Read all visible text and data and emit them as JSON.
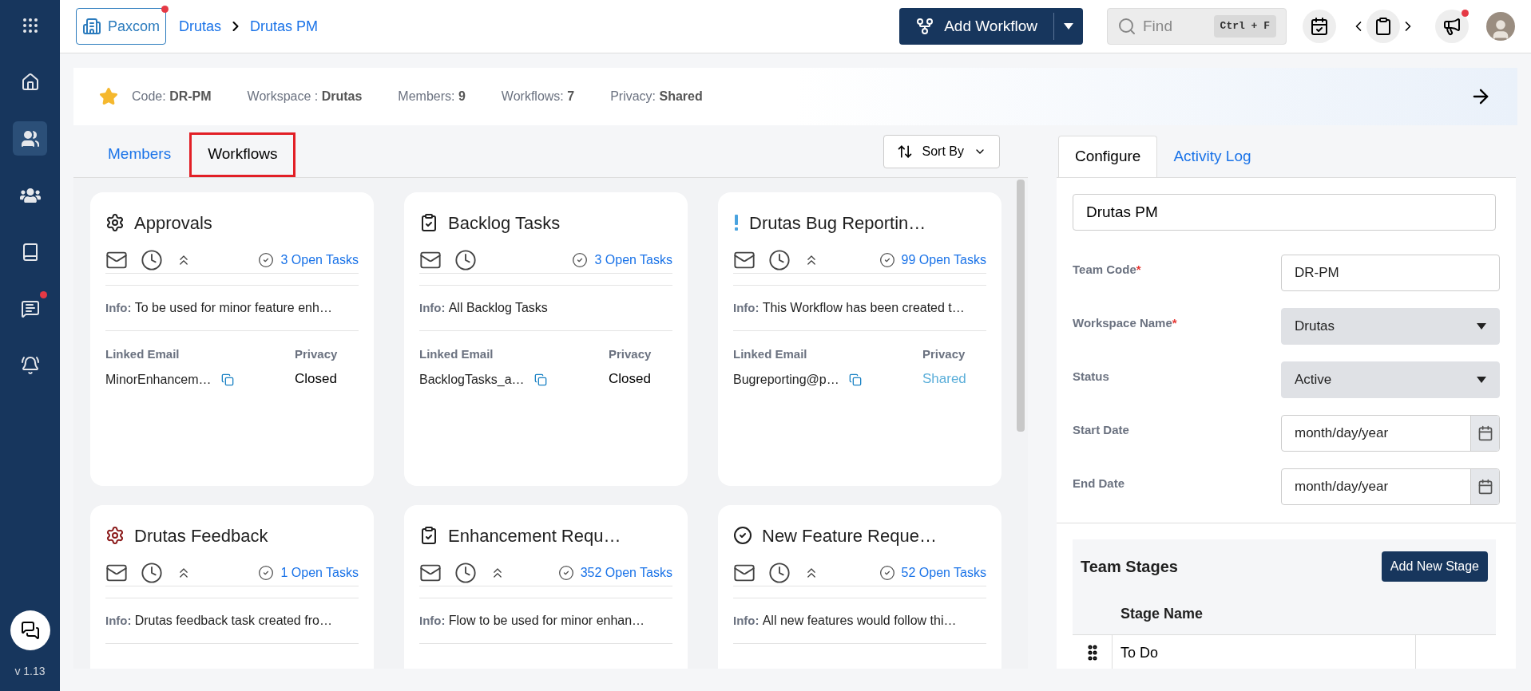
{
  "sidebar": {
    "items": [
      {
        "kind": "apps",
        "selected": false,
        "notification": false
      },
      {
        "kind": "home",
        "selected": false,
        "notification": false
      },
      {
        "kind": "teams",
        "selected": true,
        "notification": false
      },
      {
        "kind": "groups",
        "selected": false,
        "notification": false
      },
      {
        "kind": "books",
        "selected": false,
        "notification": false
      },
      {
        "kind": "chat",
        "selected": false,
        "notification": true
      },
      {
        "kind": "alerts",
        "selected": false,
        "notification": false
      }
    ],
    "version": "v 1.13"
  },
  "header": {
    "workspace": {
      "label": "Paxcom",
      "notification": true
    },
    "breadcrumb": [
      "Drutas",
      "Drutas PM"
    ],
    "add_button": "Add Workflow",
    "search": {
      "placeholder": "Find",
      "shortcut": "Ctrl + F"
    },
    "megaphone_notification": true
  },
  "info_strip": [
    {
      "label": "Code:",
      "value": "DR-PM"
    },
    {
      "label": "Workspace :",
      "value": "Drutas"
    },
    {
      "label": "Members:",
      "value": "9"
    },
    {
      "label": "Workflows:",
      "value": "7"
    },
    {
      "label": "Privacy:",
      "value": "Shared"
    }
  ],
  "tabs": [
    {
      "label": "Members",
      "selected": false
    },
    {
      "label": "Workflows",
      "selected": true
    }
  ],
  "sort_button": "Sort By",
  "workflows": [
    {
      "title": "Approvals",
      "kind": "gear",
      "color": "#1f1f1f",
      "priority": true,
      "open_tasks": "3 Open Tasks",
      "info_label": "Info:",
      "info": "To be used for minor feature enh…",
      "email_label": "Linked Email",
      "email": "MinorEnhancem…",
      "privacy_label": "Privacy",
      "privacy": "Closed",
      "shared": false
    },
    {
      "title": "Backlog Tasks",
      "kind": "clipboard",
      "color": "#1f1f1f",
      "priority": false,
      "open_tasks": "3 Open Tasks",
      "info_label": "Info:",
      "info": "All Backlog Tasks",
      "email_label": "Linked Email",
      "email": "BacklogTasks_a…",
      "privacy_label": "Privacy",
      "privacy": "Closed",
      "shared": false
    },
    {
      "title": "Drutas Bug Reportin…",
      "kind": "alert",
      "color": "#4aa3df",
      "priority": true,
      "open_tasks": "99 Open Tasks",
      "info_label": "Info:",
      "info": "This Workflow has been created t…",
      "email_label": "Linked Email",
      "email": "Bugreporting@p…",
      "privacy_label": "Privacy",
      "privacy": "Shared",
      "shared": true
    },
    {
      "title": "Drutas Feedback",
      "kind": "gear",
      "color": "#8b1a1a",
      "priority": true,
      "open_tasks": "1 Open Tasks",
      "info_label": "Info:",
      "info": "Drutas feedback task created fro…"
    },
    {
      "title": "Enhancement Requ…",
      "kind": "clipboard",
      "color": "#1f1f1f",
      "priority": true,
      "open_tasks": "352 Open Tasks",
      "info_label": "Info:",
      "info": "Flow to be used for minor enhan…"
    },
    {
      "title": "New Feature Reque…",
      "kind": "check",
      "color": "#1f1f1f",
      "priority": true,
      "open_tasks": "52 Open Tasks",
      "info_label": "Info:",
      "info": "All new features would follow thi…"
    }
  ],
  "panel": {
    "tabs": [
      {
        "label": "Configure",
        "selected": true
      },
      {
        "label": "Activity Log",
        "selected": false
      }
    ],
    "name_value": "Drutas PM",
    "fields": [
      {
        "label": "Team Code",
        "required_mark": "*",
        "kind": "text",
        "value": "DR-PM"
      },
      {
        "label": "Workspace Name",
        "required_mark": "*",
        "kind": "select",
        "value": "Drutas"
      },
      {
        "label": "Status",
        "kind": "select",
        "value": "Active"
      },
      {
        "label": "Start Date",
        "kind": "date",
        "placeholder": "month/day/year"
      },
      {
        "label": "End Date",
        "kind": "date",
        "placeholder": "month/day/year"
      }
    ],
    "stages": {
      "title": "Team Stages",
      "add_button": "Add New Stage",
      "column": "Stage Name",
      "rows": [
        "To Do"
      ]
    }
  }
}
